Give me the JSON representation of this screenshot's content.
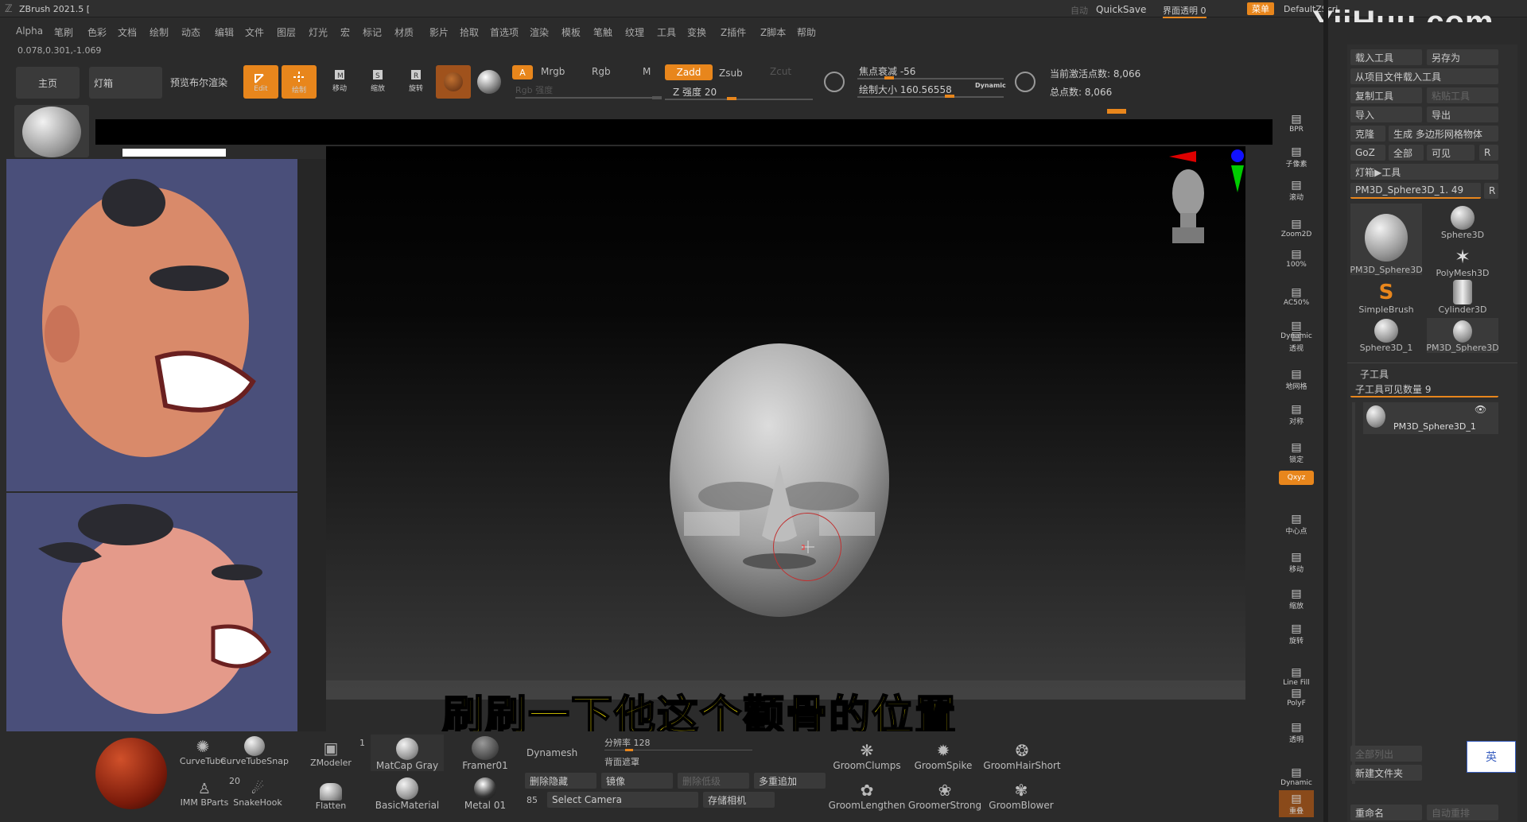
{
  "title_bar": {
    "app_title": "ZBrush 2021.5 [",
    "auto_label": "自动",
    "quicksave": "QuickSave",
    "ui_transparency": "界面透明 0",
    "menus_btn": "菜单",
    "default_script": "DefaultZScri",
    "watermark": "YiiHuu.com"
  },
  "menu": [
    "Alpha",
    "笔刷",
    "色彩",
    "文档",
    "绘制",
    "动态",
    "编辑",
    "文件",
    "图层",
    "灯光",
    "宏",
    "标记",
    "材质",
    "影片",
    "拾取",
    "首选项",
    "渲染",
    "模板",
    "笔触",
    "纹理",
    "工具",
    "变换",
    "Z插件",
    "Z脚本",
    "帮助"
  ],
  "coords": "0.078,0.301,-1.069",
  "toolbar": {
    "home": "主页",
    "lightbox": "灯箱",
    "bpr_preview": "预览布尔渲染",
    "edit": "Edit",
    "draw": "绘制",
    "move": "移动",
    "scale": "缩放",
    "rotate": "旋转",
    "a_btn": "A",
    "mrgb": "Mrgb",
    "rgb": "Rgb",
    "m": "M",
    "zadd": "Zadd",
    "zsub": "Zsub",
    "zcut": "Zcut",
    "rgb_intensity": "Rgb 强度",
    "z_intensity": "Z 强度 20",
    "focal_shift": "焦点衰减 -56",
    "draw_size": "绘制大小 160.56558",
    "dynamic": "Dynamic",
    "active_points": "当前激活点数: 8,066",
    "total_points": "总点数: 8,066"
  },
  "canvas": {
    "subtitle": "刷刷一下他这个颧骨的位置"
  },
  "right_rail": [
    "BPR",
    "子像素",
    "滚动",
    "Zoom2D",
    "100%",
    "AC50%",
    "Dynamic",
    "透视",
    "地网格",
    "对称",
    "锁定",
    "Qxyz",
    "中心点",
    "移动",
    "缩放",
    "旋转",
    "Line Fill",
    "PolyF",
    "透明",
    "Dynamic",
    "重叠"
  ],
  "tool_panel": {
    "load_tool": "载入工具",
    "save_as": "另存为",
    "load_from_project": "从项目文件载入工具",
    "copy_tool": "复制工具",
    "paste_tool": "粘贴工具",
    "import": "导入",
    "export": "导出",
    "clone": "克隆",
    "make_polymesh": "生成 多边形网格物体",
    "goz": "GoZ",
    "all": "全部",
    "visible": "可见",
    "r": "R",
    "lightbox_tools": "灯箱▶工具",
    "current_tool": "PM3D_Sphere3D_1. 49",
    "tools": [
      "PM3D_Sphere3D",
      "Sphere3D",
      "PolyMesh3D",
      "SimpleBrush",
      "Cylinder3D",
      "Sphere3D_1",
      "PM3D_Sphere3D"
    ],
    "subtool_title": "子工具",
    "subtool_count": "子工具可见数量 9",
    "subtool_name": "PM3D_Sphere3D_1",
    "list_all": "全部列出",
    "new_folder": "新建文件夹",
    "rename": "重命名",
    "auto_reorder": "自动重排",
    "ime": "英"
  },
  "bottom": {
    "brushes": [
      "CurveTube",
      "CurveTubeSnap",
      "ZModeler",
      "IMM BParts",
      "SnakeHook",
      "Flatten"
    ],
    "brush_count": "20",
    "zmodeler_num": "1",
    "materials": [
      "MatCap Gray",
      "BasicMaterial",
      "Framer01",
      "Metal 01"
    ],
    "dynamesh": "Dynamesh",
    "resolution": "分辨率 128",
    "backface_mask": "背面遮罩",
    "del_hidden": "删除隐藏",
    "mirror": "镜像",
    "del_lower": "删除低级",
    "add_subdiv": "多重追加",
    "num85": "85",
    "select_camera": "Select Camera",
    "store_camera": "存储相机",
    "groom": [
      "GroomClumps",
      "GroomSpike",
      "GroomHairShort",
      "GroomLengthen",
      "GroomerStrong",
      "GroomBlower"
    ]
  },
  "colors": {
    "accent": "#e8861c",
    "bg": "#2b2b2b",
    "panel": "#3a3a3a",
    "ref_bg": "#4a4f7a"
  }
}
